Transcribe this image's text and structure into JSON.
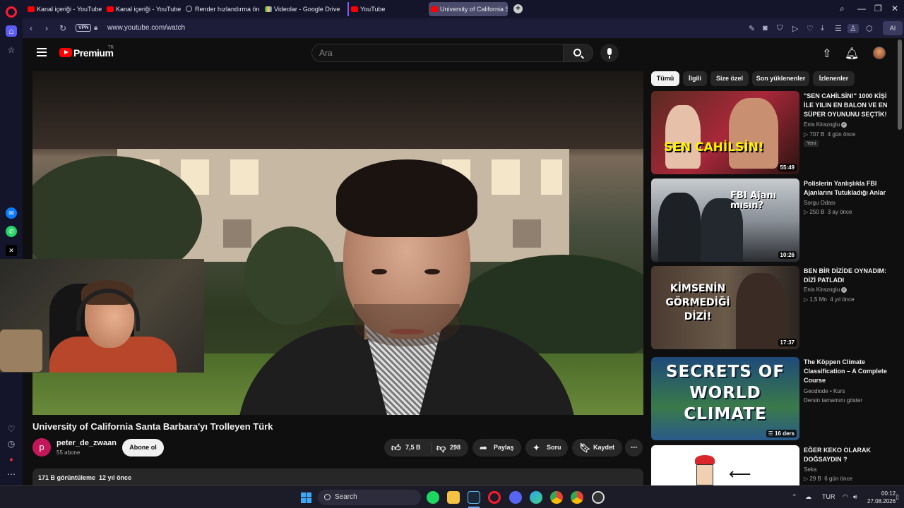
{
  "browser": {
    "tabs": [
      {
        "label": "Kanal içeriği - YouTube St",
        "icon": "youtube-icon"
      },
      {
        "label": "Kanal içeriği - YouTube St",
        "icon": "youtube-icon"
      },
      {
        "label": "Render hızlandırma önerile",
        "icon": "loading-icon"
      },
      {
        "label": "Videolar - Google Drive",
        "icon": "drive-icon"
      },
      {
        "label": "YouTube",
        "icon": "youtube-icon"
      },
      {
        "label": "University of California Sa",
        "icon": "youtube-icon"
      }
    ],
    "url": "www.youtube.com/watch",
    "vpn_label": "VPN",
    "ai_label": "AI"
  },
  "yt": {
    "brand": "Premium",
    "region": "TR",
    "search_placeholder": "Ara"
  },
  "video": {
    "title": "University of California Santa Barbara'yı Trolleyen Türk",
    "channel": {
      "name": "peter_de_zwaan",
      "initial": "p",
      "subscribers": "55 abone"
    },
    "subscribe_label": "Abone ol",
    "likes": "7,5 B",
    "dislikes": "298",
    "share_label": "Paylaş",
    "ask_label": "Soru",
    "save_label": "Kaydet",
    "views": "171 B görüntüleme",
    "age": "12 yıl önce"
  },
  "chips": [
    "Tümü",
    "İlgili",
    "Size özel",
    "Son yüklenenler",
    "İzlenenler"
  ],
  "recommendations": [
    {
      "title": "\"SEN CAHİLSİN!\" 1000 KİŞİ İLE YILIN EN BALON VE EN SÜPER OYUNUNU SEÇTİK!",
      "channel": "Enis Kirazoglu",
      "verified": true,
      "views": "707 B",
      "age": "4 gün önce",
      "badge": "Yeni",
      "duration": "55:49",
      "thumb_text": "SEN CAHİLSİN!"
    },
    {
      "title": "Polislerin Yanlışlıkla FBI Ajanlarını Tutukladığı Anlar",
      "channel": "Sorgu Odası",
      "verified": false,
      "views": "250 B",
      "age": "3 ay önce",
      "duration": "10:26",
      "thumb_text": "FBI Ajanı mısın?"
    },
    {
      "title": "BEN BİR DİZİDE OYNADIM: DİZİ PATLADI",
      "channel": "Enis Kirazoglu",
      "verified": true,
      "views": "1,5 Mn",
      "age": "4 yıl önce",
      "duration": "17:37",
      "thumb_text": "KİMSENİN GÖRMEDİĞİ DİZİ!"
    },
    {
      "title": "The Köppen Climate Classification – A Complete Course",
      "channel": "Geodiode • Kurs",
      "verified": false,
      "meta": "Dersin tamamını göster",
      "duration": "16 ders",
      "thumb_text": "SECRETS OF WORLD CLIMATE"
    },
    {
      "title": "EĞER KEKO OLARAK DOĞSAYDIN ?",
      "channel": "Seka",
      "verified": false,
      "views": "29 B",
      "age": "6 gün önce",
      "duration": ""
    }
  ],
  "taskbar": {
    "search_label": "Search",
    "lang": "TUR",
    "time": "00:12",
    "date": "27.08.2026"
  }
}
